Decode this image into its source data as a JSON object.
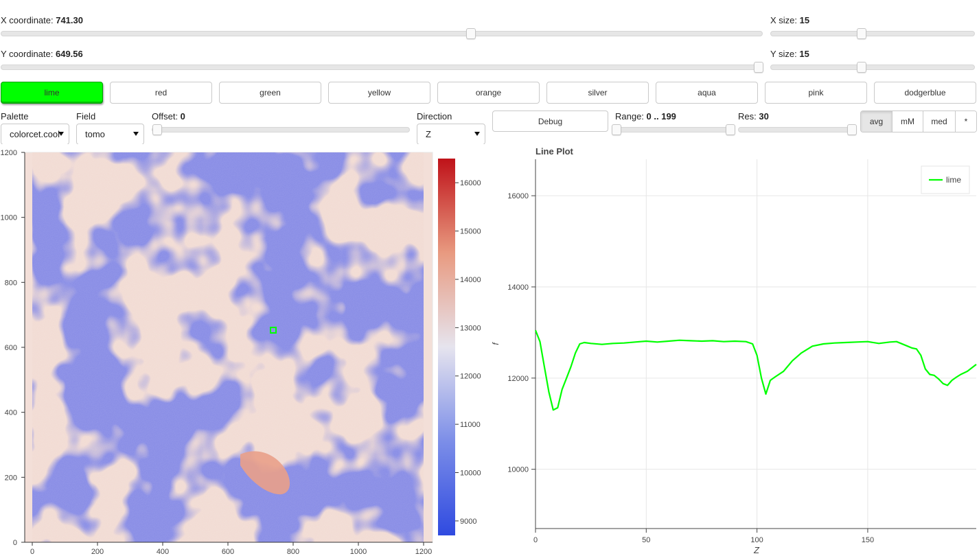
{
  "controls": {
    "x_coord": {
      "label": "X coordinate: ",
      "value": "741.30",
      "fraction": 0.618
    },
    "y_coord": {
      "label": "Y coordinate: ",
      "value": "649.56",
      "fraction": 1.0
    },
    "x_size": {
      "label": "X size: ",
      "value": "15",
      "fraction": 0.44
    },
    "y_size": {
      "label": "Y size: ",
      "value": "15",
      "fraction": 0.44
    }
  },
  "color_buttons": [
    {
      "label": "lime",
      "active": true
    },
    {
      "label": "red",
      "active": false
    },
    {
      "label": "green",
      "active": false
    },
    {
      "label": "yellow",
      "active": false
    },
    {
      "label": "orange",
      "active": false
    },
    {
      "label": "silver",
      "active": false
    },
    {
      "label": "aqua",
      "active": false
    },
    {
      "label": "pink",
      "active": false
    },
    {
      "label": "dodgerblue",
      "active": false
    }
  ],
  "palette": {
    "label": "Palette",
    "value": "colorcet.cool"
  },
  "field": {
    "label": "Field",
    "value": "tomo"
  },
  "offset": {
    "label": "Offset: ",
    "value": "0",
    "fraction": 0.0
  },
  "direction": {
    "label": "Direction",
    "value": "Z"
  },
  "debug_label": "Debug",
  "range": {
    "label": "Range: ",
    "value": "0 .. 199",
    "low": 0,
    "high": 199
  },
  "res": {
    "label": "Res: ",
    "value": "30",
    "fraction": 1.0
  },
  "stat_modes": [
    {
      "label": "avg",
      "active": true
    },
    {
      "label": "mM",
      "active": false
    },
    {
      "label": "med",
      "active": false
    },
    {
      "label": "*",
      "active": false
    }
  ],
  "image_view": {
    "x_ticks": [
      "0",
      "200",
      "400",
      "600",
      "800",
      "1000",
      "1200"
    ],
    "y_ticks": [
      "0",
      "200",
      "400",
      "600",
      "800",
      "1000",
      "1200"
    ],
    "colorbar_ticks": [
      "9000",
      "10000",
      "11000",
      "12000",
      "13000",
      "14000",
      "15000",
      "16000"
    ],
    "colorbar_range": [
      8700,
      16500
    ],
    "selection": {
      "x": 741.3,
      "y": 649.56
    },
    "colors": {
      "low": "#3a4fe0",
      "mid": "#ecebec",
      "high": "#c0161e",
      "grain": "#f2d9d2",
      "pore": "#8a8ee6"
    }
  },
  "line_plot": {
    "title": "Line Plot",
    "legend": "lime",
    "line_color": "#00ff00"
  },
  "chart_data": {
    "type": "line",
    "title": "Line Plot",
    "xlabel": "Z",
    "ylabel": "f",
    "xlim": [
      0,
      199
    ],
    "ylim": [
      8700,
      16800
    ],
    "x_ticks": [
      "0",
      "50",
      "100",
      "150"
    ],
    "y_ticks": [
      "10000",
      "12000",
      "14000",
      "16000"
    ],
    "grid": true,
    "legend_position": "top-right",
    "series": [
      {
        "name": "lime",
        "color": "#00ff00",
        "x": [
          0,
          2,
          4,
          6,
          8,
          10,
          12,
          14,
          16,
          18,
          20,
          22,
          25,
          30,
          35,
          40,
          45,
          50,
          55,
          60,
          65,
          70,
          75,
          80,
          85,
          90,
          95,
          98,
          100,
          102,
          104,
          106,
          108,
          112,
          116,
          120,
          125,
          130,
          135,
          140,
          145,
          150,
          155,
          160,
          163,
          165,
          168,
          170,
          172,
          174,
          176,
          178,
          180,
          182,
          184,
          186,
          188,
          190,
          192,
          195,
          199
        ],
        "y": [
          13050,
          12800,
          12250,
          11700,
          11300,
          11350,
          11750,
          12000,
          12250,
          12550,
          12750,
          12780,
          12760,
          12740,
          12760,
          12770,
          12790,
          12810,
          12790,
          12810,
          12830,
          12820,
          12810,
          12820,
          12800,
          12810,
          12800,
          12750,
          12500,
          12000,
          11650,
          11950,
          12020,
          12150,
          12380,
          12550,
          12700,
          12750,
          12770,
          12780,
          12790,
          12800,
          12760,
          12790,
          12800,
          12760,
          12700,
          12660,
          12640,
          12500,
          12200,
          12080,
          12060,
          11980,
          11880,
          11840,
          11950,
          12020,
          12080,
          12150,
          12300
        ]
      }
    ]
  }
}
